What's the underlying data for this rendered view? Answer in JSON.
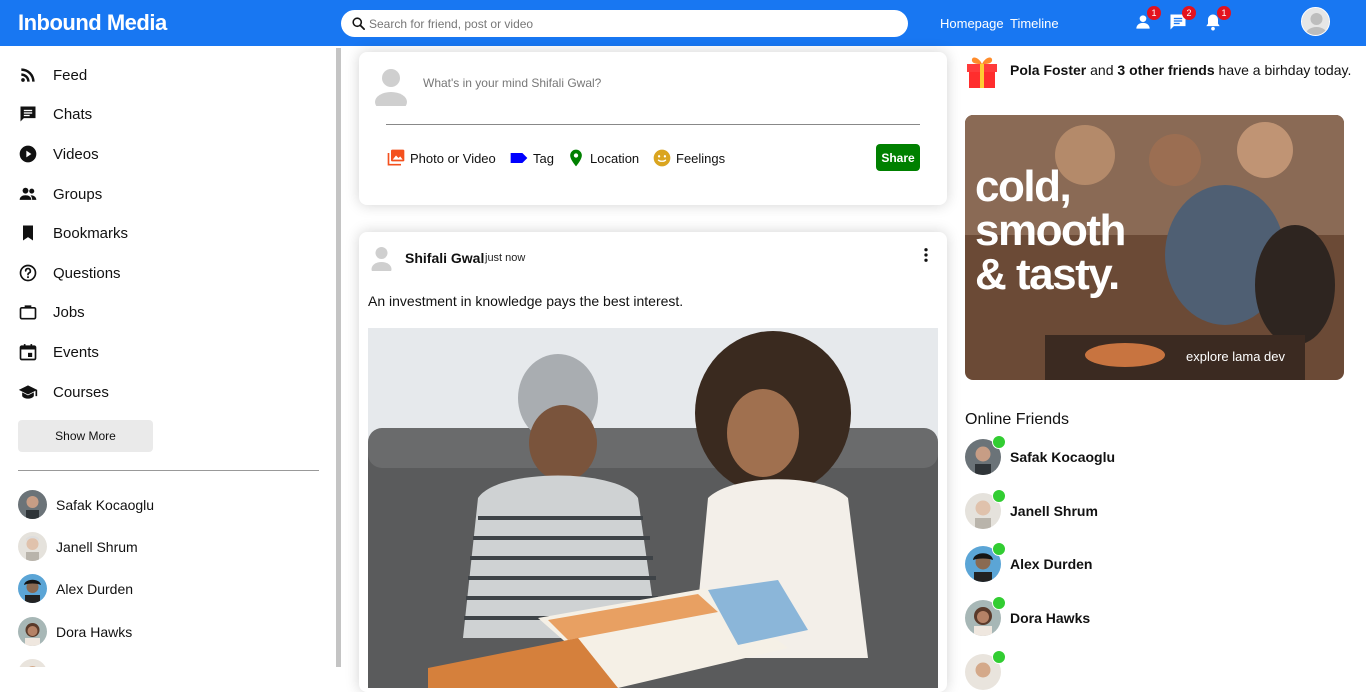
{
  "topbar": {
    "logo": "Inbound Media",
    "search_placeholder": "Search for friend, post or video",
    "links": [
      "Homepage",
      "Timeline"
    ],
    "badges": {
      "friend_requests": "1",
      "messages": "2",
      "notifications": "1"
    }
  },
  "sidebar": {
    "items": [
      {
        "label": "Feed",
        "icon": "rss-feed-icon"
      },
      {
        "label": "Chats",
        "icon": "chat-icon"
      },
      {
        "label": "Videos",
        "icon": "play-circle-icon"
      },
      {
        "label": "Groups",
        "icon": "group-icon"
      },
      {
        "label": "Bookmarks",
        "icon": "bookmark-icon"
      },
      {
        "label": "Questions",
        "icon": "help-circle-icon"
      },
      {
        "label": "Jobs",
        "icon": "briefcase-icon"
      },
      {
        "label": "Events",
        "icon": "calendar-icon"
      },
      {
        "label": "Courses",
        "icon": "school-icon"
      }
    ],
    "show_more": "Show More",
    "friends": [
      "Safak Kocaoglu",
      "Janell Shrum",
      "Alex Durden",
      "Dora Hawks"
    ]
  },
  "share": {
    "placeholder": "What's in your mind Shifali Gwal?",
    "options": {
      "photo": "Photo or Video",
      "tag": "Tag",
      "location": "Location",
      "feelings": "Feelings"
    },
    "share_button": "Share"
  },
  "post": {
    "username": "Shifali Gwal",
    "time": "just now",
    "text": "An investment in knowledge pays the best interest."
  },
  "rightbar": {
    "birthday": {
      "name": "Pola Foster",
      "middle": " and ",
      "others": "3 other friends",
      "suffix": " have a birhday today."
    },
    "ad": {
      "headline": "cold,\nsmooth\n& tasty.",
      "sub": "explore lama dev"
    },
    "online_title": "Online Friends",
    "online_friends": [
      "Safak Kocaoglu",
      "Janell Shrum",
      "Alex Durden",
      "Dora Hawks"
    ]
  },
  "colors": {
    "primary": "#1877f2",
    "share_button": "#008000",
    "badge": "#e4121e",
    "online": "#32cd32"
  }
}
